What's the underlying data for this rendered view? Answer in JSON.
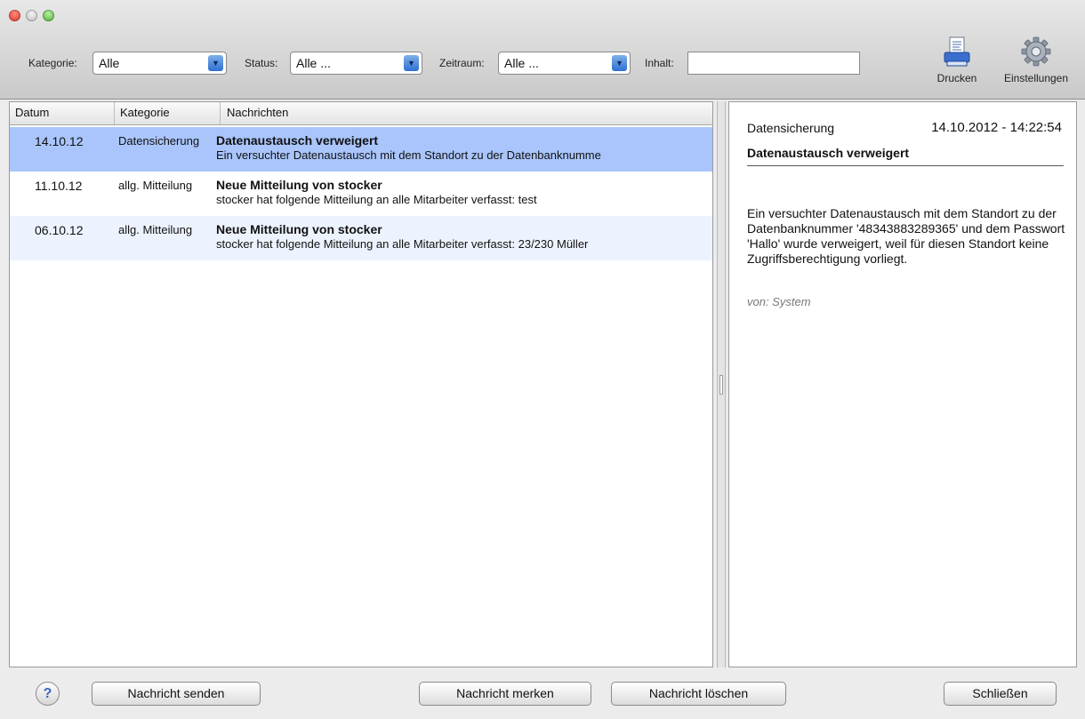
{
  "toolbar": {
    "filters": [
      {
        "label": "Kategorie:",
        "value": "Alle"
      },
      {
        "label": "Status:",
        "value": "Alle ..."
      },
      {
        "label": "Zeitraum:",
        "value": "Alle ..."
      }
    ],
    "content_label": "Inhalt:",
    "content_value": "",
    "print_label": "Drucken",
    "settings_label": "Einstellungen"
  },
  "list": {
    "columns": [
      "Datum",
      "Kategorie",
      "Nachrichten"
    ],
    "rows": [
      {
        "date": "14.10.12",
        "category": "Datensicherung",
        "subject": "Datenaustausch verweigert",
        "body": "Ein versuchter Datenaustausch mit dem Standort zu der Datenbanknumme"
      },
      {
        "date": "11.10.12",
        "category": "allg. Mitteilung",
        "subject": "Neue Mitteilung von stocker",
        "body": "stocker hat folgende Mitteilung an alle Mitarbeiter verfasst: test"
      },
      {
        "date": "06.10.12",
        "category": "allg. Mitteilung",
        "subject": "Neue Mitteilung von stocker",
        "body": "stocker hat folgende Mitteilung an alle Mitarbeiter verfasst: 23/230 Müller"
      }
    ]
  },
  "detail": {
    "category": "Datensicherung",
    "timestamp": "14.10.2012 - 14:22:54",
    "subject": "Datenaustausch verweigert",
    "body": "Ein versuchter Datenaustausch mit dem Standort zu der Datenbanknummer '48343883289365' und dem Passwort 'Hallo' wurde verweigert, weil für diesen Standort keine Zugriffsberechtigung vorliegt.",
    "from": "von: System"
  },
  "footer": {
    "help_label": "?",
    "send_label": "Nachricht senden",
    "mark_label": "Nachricht merken",
    "delete_label": "Nachricht löschen",
    "close_label": "Schließen"
  },
  "colors": {
    "selected_row": "#a9c5fb",
    "alt_row": "#edf3fe",
    "accent": "#3b79d8"
  },
  "icons": {
    "print": "printer-icon",
    "settings": "gear-icon",
    "help": "help-icon",
    "dropdown": "chevron-down-icon"
  }
}
